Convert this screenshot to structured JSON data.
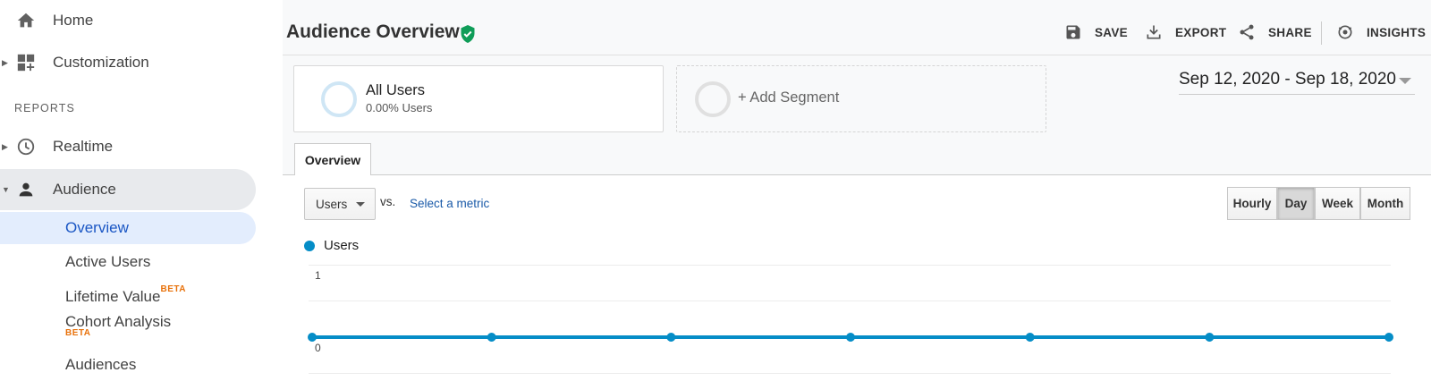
{
  "sidebar": {
    "home": {
      "label": "Home",
      "icon": "home-icon"
    },
    "customization": {
      "label": "Customization",
      "icon": "dashboard-plus-icon"
    },
    "section_label": "REPORTS",
    "realtime": {
      "label": "Realtime",
      "icon": "clock-icon"
    },
    "audience": {
      "label": "Audience",
      "icon": "person-icon"
    },
    "sub_items": [
      {
        "label": "Overview",
        "active": true
      },
      {
        "label": "Active Users"
      },
      {
        "label": "Lifetime Value",
        "badge": "BETA"
      },
      {
        "label": "Cohort Analysis",
        "badge": "BETA"
      },
      {
        "label": "Audiences"
      }
    ]
  },
  "header": {
    "title": "Audience Overview",
    "verified_icon": "shield-check-icon",
    "actions": [
      {
        "label": "SAVE",
        "icon": "save-icon"
      },
      {
        "label": "EXPORT",
        "icon": "download-icon"
      },
      {
        "label": "SHARE",
        "icon": "share-icon"
      },
      {
        "label": "INSIGHTS",
        "icon": "insights-icon"
      }
    ]
  },
  "segments": {
    "primary": {
      "name": "All Users",
      "sub": "0.00% Users"
    },
    "add_label": "+ Add Segment"
  },
  "date_range": "Sep 12, 2020 - Sep 18, 2020",
  "tabs": {
    "overview": "Overview"
  },
  "controls": {
    "metric": "Users",
    "vs": "vs.",
    "select_metric": "Select a metric",
    "granularity": [
      "Hourly",
      "Day",
      "Week",
      "Month"
    ],
    "granularity_selected": "Day"
  },
  "chart_data": {
    "type": "line",
    "series": [
      {
        "name": "Users",
        "values": [
          0,
          0,
          0,
          0,
          0,
          0,
          0
        ]
      }
    ],
    "y_ticks": [
      "1",
      "0"
    ],
    "ylim": [
      0,
      1
    ],
    "color": "#058dc7"
  }
}
